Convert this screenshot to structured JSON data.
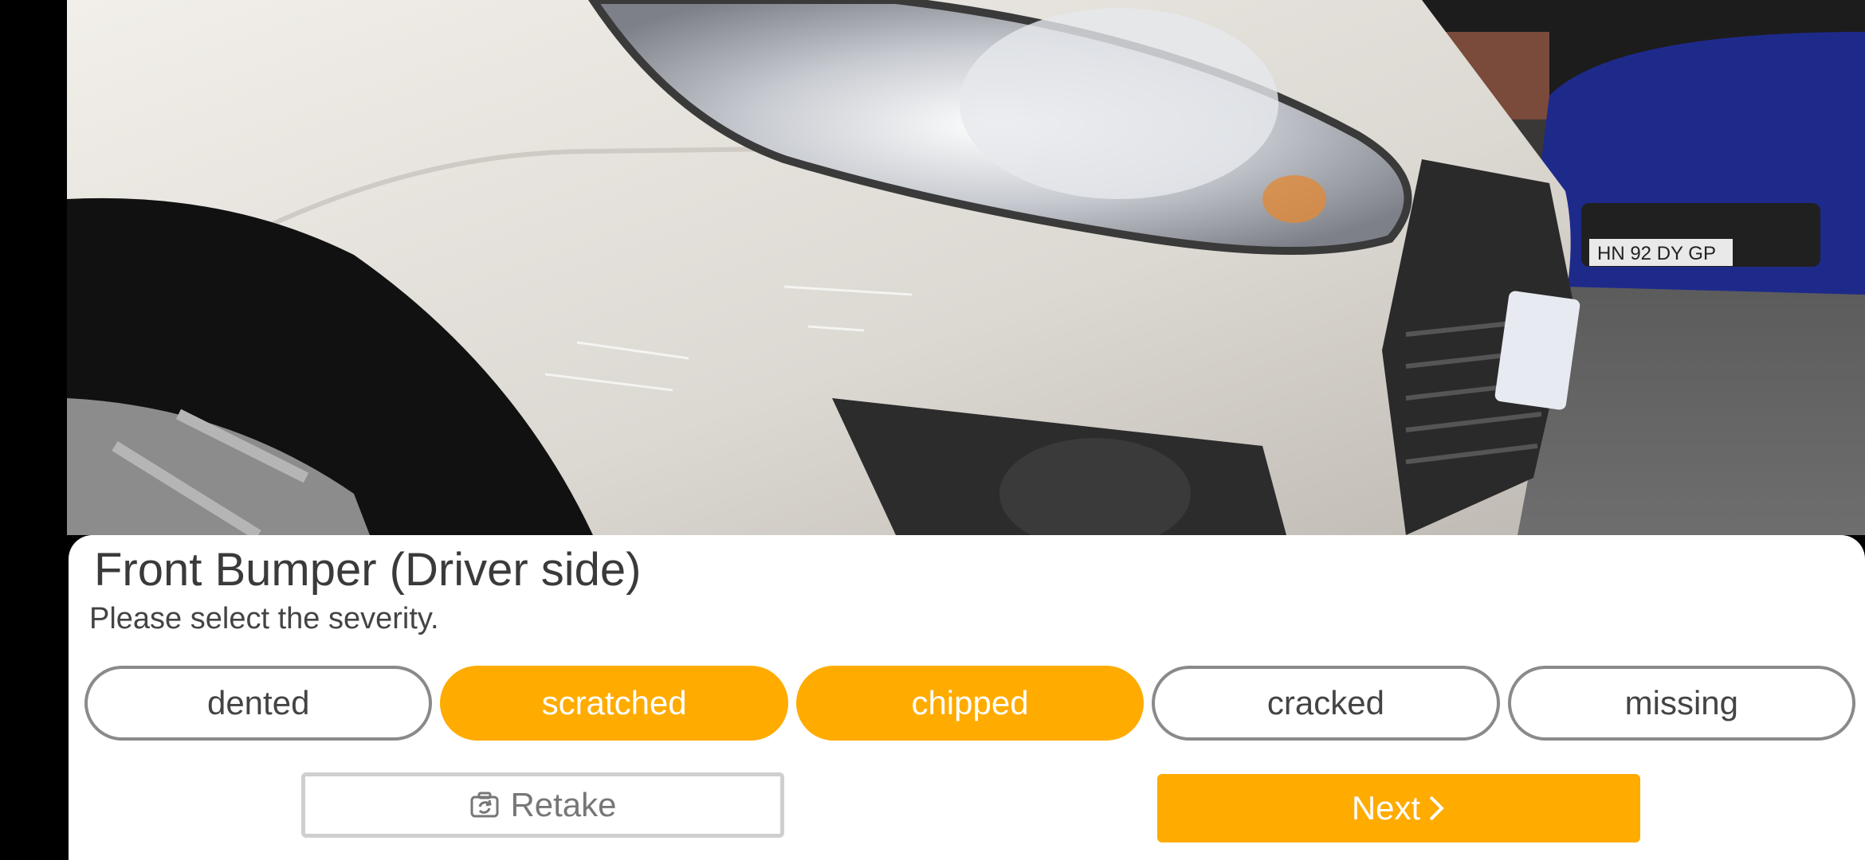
{
  "photo": {
    "subject": "front-bumper-driver-side-photo"
  },
  "panel": {
    "title": "Front Bumper (Driver side)",
    "subtitle": "Please select the severity."
  },
  "severity_options": [
    {
      "label": "dented",
      "selected": false
    },
    {
      "label": "scratched",
      "selected": true
    },
    {
      "label": "chipped",
      "selected": true
    },
    {
      "label": "cracked",
      "selected": false
    },
    {
      "label": "missing",
      "selected": false
    }
  ],
  "actions": {
    "retake_label": "Retake",
    "retake_icon": "camera-rotate-icon",
    "next_label": "Next",
    "next_icon": "chevron-right-icon"
  },
  "colors": {
    "accent": "#ffab00",
    "chip_border": "#8a8a8a",
    "panel_bg": "#ffffff"
  }
}
